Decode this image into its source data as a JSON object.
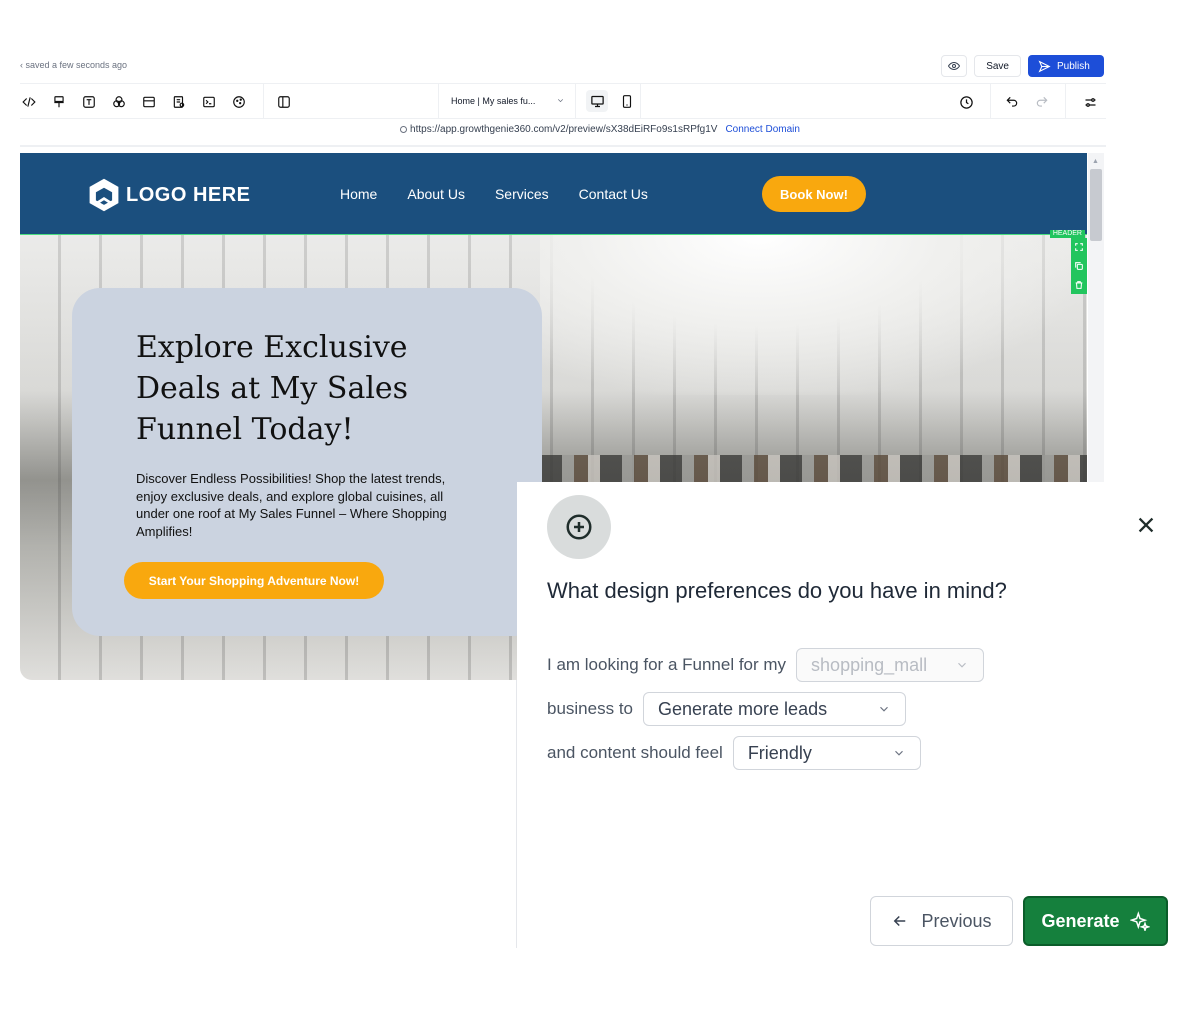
{
  "topbar": {
    "saved_status": "‹ saved a few seconds ago",
    "save_label": "Save",
    "publish_label": "Publish"
  },
  "toolbar": {
    "page_select": "Home | My sales fu...",
    "tools": [
      "code-icon",
      "brush-icon",
      "text-icon",
      "elements-icon",
      "section-icon",
      "form-icon",
      "terminal-icon",
      "cookie-icon",
      "layout-icon"
    ]
  },
  "urlbar": {
    "url": "https://app.growthgenie360.com/v2/preview/sX38dEiRFo9s1sRPfg1V",
    "connect_domain": "Connect Domain"
  },
  "site": {
    "logo_text": "LOGO HERE",
    "nav": [
      "Home",
      "About Us",
      "Services",
      "Contact Us"
    ],
    "book_label": "Book Now!",
    "header_tag": "HEADER",
    "hero_title": "Explore Exclusive Deals at My Sales Funnel Today!",
    "hero_sub": "Discover Endless Possibilities! Shop the latest trends, enjoy exclusive deals, and explore global cuisines, all under one roof at My Sales Funnel – Where Shopping Amplifies!",
    "hero_cta": "Start Your Shopping Adventure Now!"
  },
  "dialog": {
    "question": "What design preferences do you have in mind?",
    "row1_label": "I am looking for a Funnel for my",
    "row1_value": "shopping_mall",
    "row2_label": "business to",
    "row2_value": "Generate more leads",
    "row3_label": "and content should feel",
    "row3_value": "Friendly",
    "previous_label": "Previous",
    "generate_label": "Generate"
  },
  "colors": {
    "header_blue": "#1b4f7e",
    "accent_orange": "#f9a80e",
    "publish_blue": "#1d4ed8",
    "generate_green": "#15803d",
    "hero_card": "#cbd3e0"
  }
}
